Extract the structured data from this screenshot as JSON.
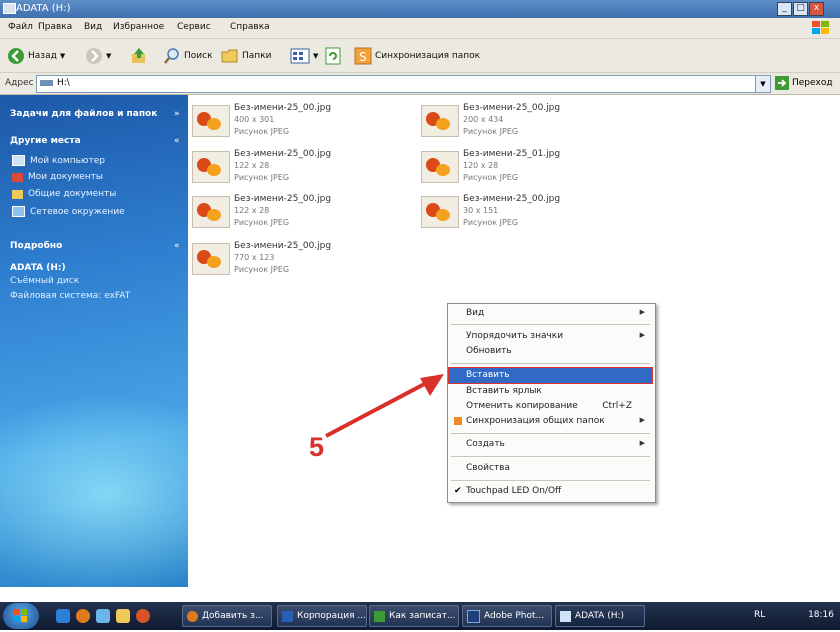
{
  "window": {
    "title": "ADATA (H:)",
    "min": "_",
    "max": "□",
    "close": "x"
  },
  "menu": [
    "Файл",
    "Правка",
    "Вид",
    "Избранное",
    "Сервис",
    "Справка"
  ],
  "toolbar": {
    "back": "Назад",
    "search": "Поиск",
    "folders": "Папки",
    "sync": "Синхронизация папок"
  },
  "address": {
    "label": "Адрес",
    "value": "H:\\",
    "go": "Переход"
  },
  "sidebar": {
    "tasks_header": "Задачи для файлов и папок",
    "places_header": "Другие места",
    "places": [
      "Мой компьютер",
      "Мои документы",
      "Общие документы",
      "Сетевое окружение"
    ],
    "details_header": "Подробно",
    "details_name": "ADATA (H:)",
    "details_type": "Съёмный диск",
    "details_fs": "Файловая система: exFAT"
  },
  "files": [
    {
      "name": "Без-имени-25_00.jpg",
      "size": "400 x 301",
      "type": "Рисунок JPEG"
    },
    {
      "name": "Без-имени-25_00.jpg",
      "size": "200 x 434",
      "type": "Рисунок JPEG"
    },
    {
      "name": "Без-имени-25_00.jpg",
      "size": "122 x 28",
      "type": "Рисунок JPEG"
    },
    {
      "name": "Без-имени-25_01.jpg",
      "size": "120 x 28",
      "type": "Рисунок JPEG"
    },
    {
      "name": "Без-имени-25_00.jpg",
      "size": "122 x 28",
      "type": "Рисунок JPEG"
    },
    {
      "name": "Без-имени-25_00.jpg",
      "size": "30 x 151",
      "type": "Рисунок JPEG"
    },
    {
      "name": "Без-имени-25_00.jpg",
      "size": "770 x 123",
      "type": "Рисунок JPEG"
    }
  ],
  "context_menu": {
    "view": "Вид",
    "arrange": "Упорядочить значки",
    "refresh": "Обновить",
    "paste": "Вставить",
    "paste_shortcut": "Вставить ярлык",
    "undo_copy": "Отменить копирование",
    "undo_shortcut": "Ctrl+Z",
    "sync": "Синхронизация общих папок",
    "new": "Создать",
    "properties": "Свойства",
    "touchpad": "Touchpad LED On/Off"
  },
  "annotation": {
    "step": "5",
    "color": "#d9302a"
  },
  "taskbar": {
    "tasks": [
      "Добавить з...",
      "Корпорация ...",
      "Как записат...",
      "Adobe Phot...",
      "ADATA (H:)"
    ],
    "lang": "RL",
    "time": "18:16"
  },
  "colors": {
    "sidebar": "#2f7fd0",
    "highlight": "#316ac5",
    "arrow": "#d9302a"
  }
}
